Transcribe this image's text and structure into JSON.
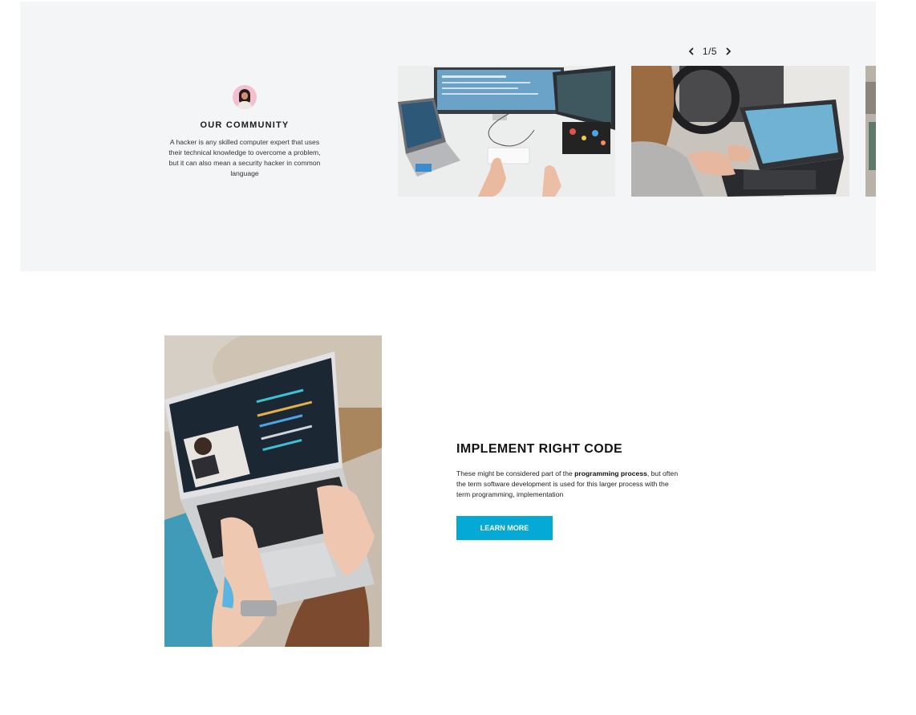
{
  "community": {
    "title": "OUR COMMUNITY",
    "text": "A hacker is any skilled computer expert that uses their technical knowledge to overcome a problem, but it can also mean a security hacker in common language",
    "avatar_icon": "user-avatar"
  },
  "carousel": {
    "current": "1",
    "separator": "/",
    "total": "5",
    "prev_icon": "chevron-left-icon",
    "next_icon": "chevron-right-icon",
    "slides": [
      {
        "subject": "dual-monitor coding desk"
      },
      {
        "subject": "laptop in car"
      },
      {
        "subject": "partial slide"
      }
    ]
  },
  "feature": {
    "title": "IMPLEMENT RIGHT CODE",
    "text_before": "These might be considered part of the ",
    "text_bold": "programming process",
    "text_after": ", but often the term software development is used for this larger process with the term programming, implementation",
    "button_label": "LEARN MORE"
  },
  "colors": {
    "band_bg": "#f4f5f7",
    "accent": "#05a9d6",
    "text": "#111111"
  }
}
